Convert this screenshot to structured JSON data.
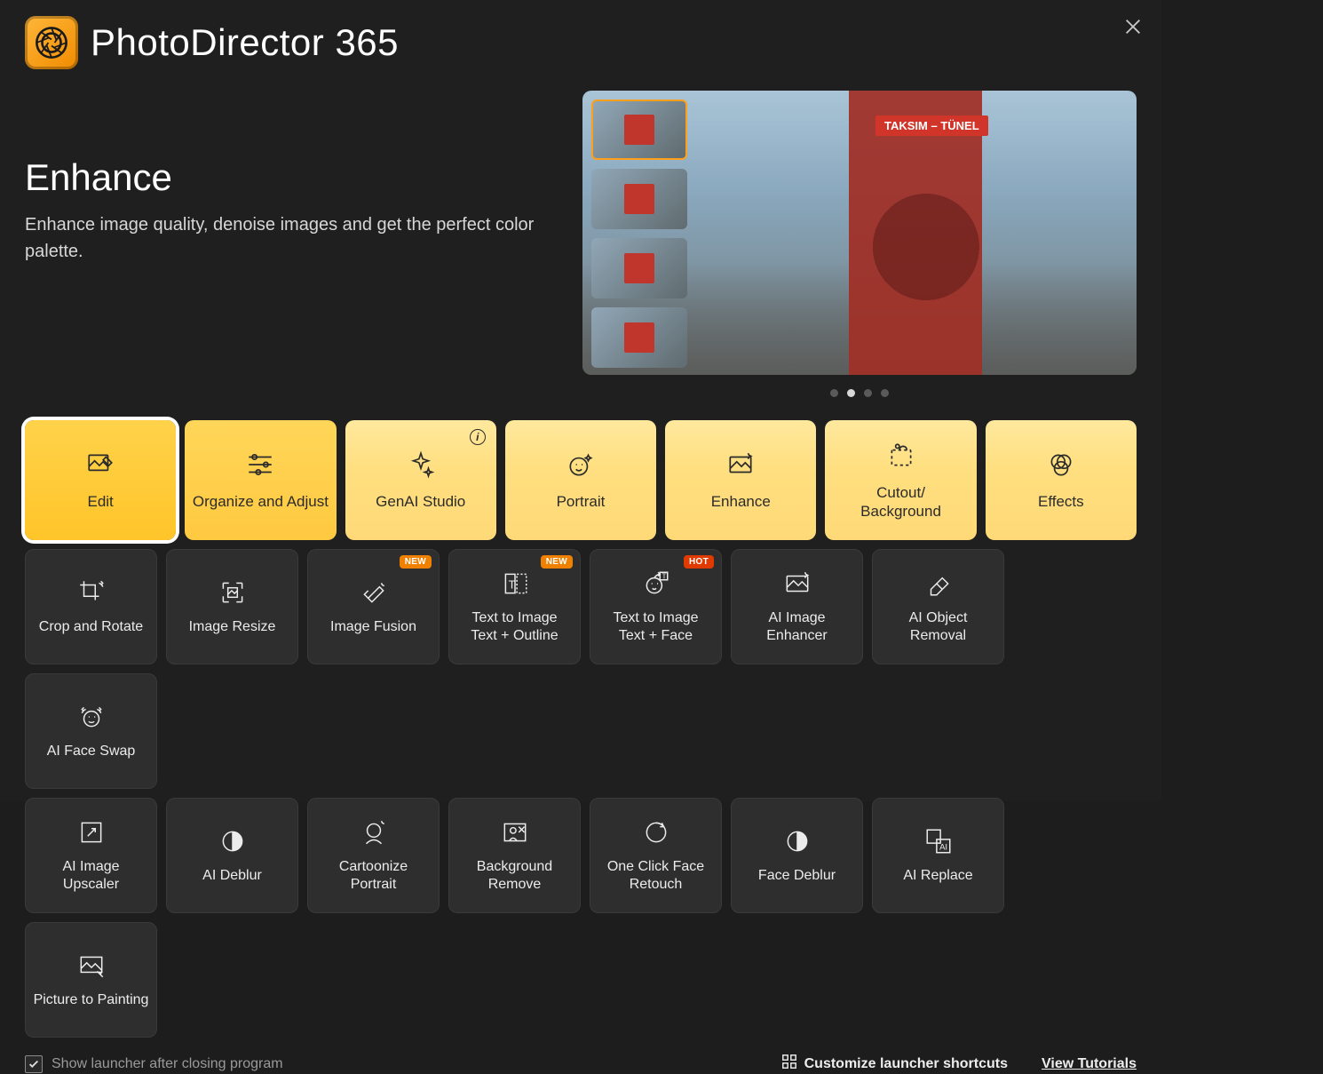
{
  "app": {
    "title": "PhotoDirector 365"
  },
  "hero": {
    "title": "Enhance",
    "subtitle": "Enhance image quality, denoise images and get the perfect color palette.",
    "tram_sign": "TAKSIM – TÜNEL",
    "active_dot": 1,
    "dot_count": 4
  },
  "categories": [
    {
      "id": "edit",
      "label": "Edit",
      "active": true
    },
    {
      "id": "organize",
      "label": "Organize and Adjust"
    },
    {
      "id": "genai",
      "label": "GenAI Studio",
      "info": true
    },
    {
      "id": "portrait",
      "label": "Portrait"
    },
    {
      "id": "enhance",
      "label": "Enhance"
    },
    {
      "id": "cutout",
      "label": "Cutout/\nBackground"
    },
    {
      "id": "effects",
      "label": "Effects"
    }
  ],
  "tools_row1": [
    {
      "id": "crop-rotate",
      "label": "Crop and Rotate"
    },
    {
      "id": "image-resize",
      "label": "Image Resize"
    },
    {
      "id": "image-fusion",
      "label": "Image Fusion",
      "tag": "NEW"
    },
    {
      "id": "t2i-outline",
      "label": "Text to Image\nText + Outline",
      "tag": "NEW"
    },
    {
      "id": "t2i-face",
      "label": "Text to Image\nText + Face",
      "tag": "HOT"
    },
    {
      "id": "ai-enhancer",
      "label": "AI Image Enhancer"
    },
    {
      "id": "ai-object-removal",
      "label": "AI Object Removal"
    },
    {
      "id": "ai-face-swap",
      "label": "AI Face Swap"
    }
  ],
  "tools_row2": [
    {
      "id": "ai-upscaler",
      "label": "AI Image Upscaler"
    },
    {
      "id": "ai-deblur",
      "label": "AI Deblur"
    },
    {
      "id": "cartoonize",
      "label": "Cartoonize Portrait"
    },
    {
      "id": "bg-remove",
      "label": "Background Remove"
    },
    {
      "id": "one-click-retouch",
      "label": "One Click Face Retouch"
    },
    {
      "id": "face-deblur",
      "label": "Face Deblur"
    },
    {
      "id": "ai-replace",
      "label": "AI Replace"
    },
    {
      "id": "picture-to-painting",
      "label": "Picture to Painting"
    }
  ],
  "footer": {
    "checkbox_checked": true,
    "checkbox_label": "Show launcher after closing program",
    "customize": "Customize launcher shortcuts",
    "tutorials": "View Tutorials"
  }
}
